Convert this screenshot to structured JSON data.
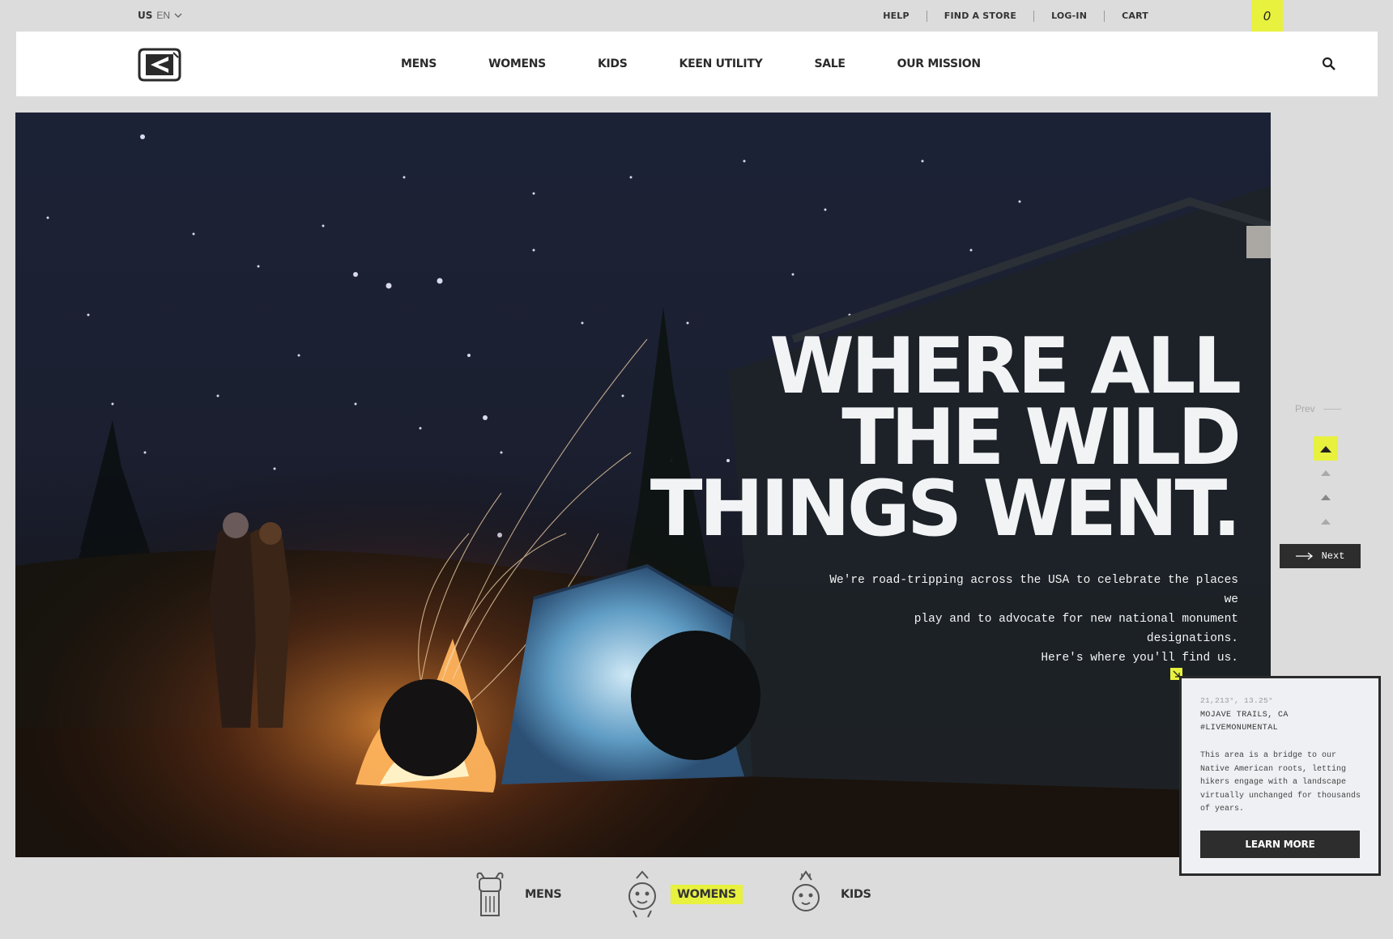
{
  "locale": {
    "country": "US",
    "language": "EN"
  },
  "utility_links": [
    "HELP",
    "FIND A STORE",
    "LOG-IN",
    "CART"
  ],
  "cart_count": "0",
  "nav": {
    "items": [
      "MENS",
      "WOMENS",
      "KIDS",
      "KEEN UTILITY",
      "SALE",
      "OUR MISSION"
    ]
  },
  "hero": {
    "headline_lines": [
      "WHERE ALL",
      "THE WILD",
      "THINGS WENT."
    ],
    "subtext_lines": [
      "We're road-tripping across the USA to celebrate the places we",
      "play and to advocate for new national monument designations.",
      "Here's where you'll find us."
    ]
  },
  "slider": {
    "prev_label": "Prev",
    "next_label": "Next"
  },
  "card": {
    "coords": "21,213°, 13.25°",
    "location_lines": [
      "MOJAVE TRAILS, CA",
      "#LIVEMONUMENTAL"
    ],
    "description": "This area is a bridge to our Native American roots, letting hikers engage with a landscape virtually unchanged for thousands of years.",
    "cta": "LEARN MORE"
  },
  "categories": [
    {
      "label": "MENS",
      "highlighted": false
    },
    {
      "label": "WOMENS",
      "highlighted": true
    },
    {
      "label": "KIDS",
      "highlighted": false
    }
  ],
  "colors": {
    "accent": "#e7f13e",
    "dark": "#2d2d2d",
    "background": "#dcdcdc"
  }
}
